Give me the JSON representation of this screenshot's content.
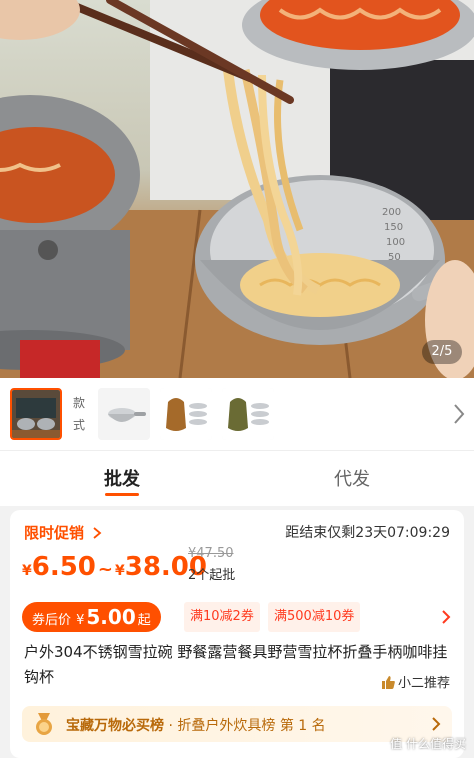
{
  "gallery": {
    "page_indicator": "2/5"
  },
  "thumbs": {
    "style_label": "款式",
    "items": [
      "main-photo",
      "bowl-with-handle",
      "bowl-set-brown-pouch",
      "bowl-set-green-pouch"
    ]
  },
  "tabs": [
    {
      "label": "批发",
      "active": true
    },
    {
      "label": "代发",
      "active": false
    }
  ],
  "promo": {
    "title": "限时促销",
    "countdown": "距结束仅剩23天07:09:29"
  },
  "price": {
    "currency": "¥",
    "low": "6.50",
    "sep": "~",
    "high": "38.00",
    "original": "¥47.50",
    "moq": "2个起批"
  },
  "coupon": {
    "label": "券后价",
    "currency": "¥",
    "value": "5.00",
    "unit": "起",
    "tags": [
      "满10减2券",
      "满500减10券"
    ]
  },
  "product": {
    "title": "户外304不锈钢雪拉碗 野餐露营餐具野营雪拉杯折叠手柄咖啡挂钩杯",
    "recommend": "小二推荐"
  },
  "ranking": {
    "prefix": "宝藏万物必买榜",
    "dot": "·",
    "category": "折叠户外炊具榜",
    "rank": "第 1 名"
  },
  "watermark": "值 什么值得买",
  "colors": {
    "accent": "#ff5000",
    "rank_text": "#b8690a"
  }
}
